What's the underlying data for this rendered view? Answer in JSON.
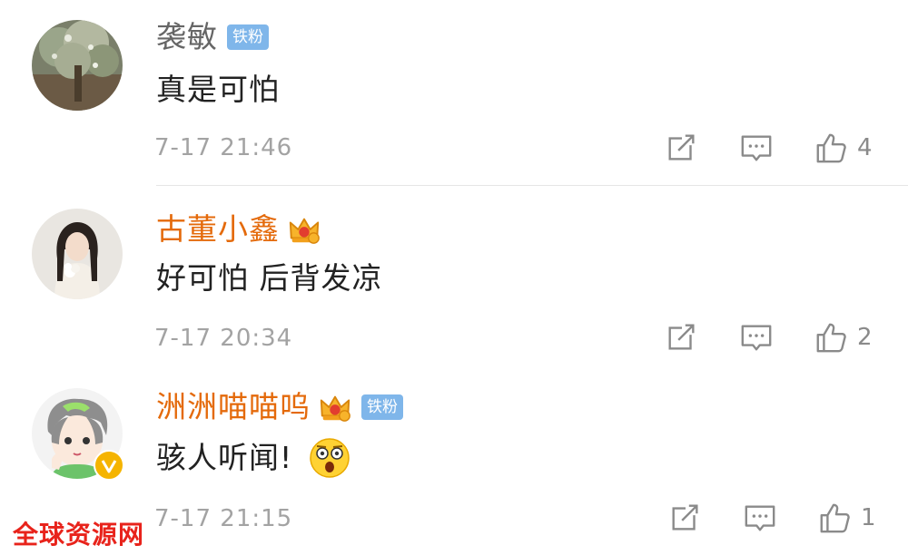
{
  "colors": {
    "username_plain": "#666666",
    "username_vip": "#e46a0b",
    "fan_badge": "#7fb6ea",
    "meta": "#a3a3a3",
    "watermark": "#e8231b"
  },
  "comments": [
    {
      "username": "袭敏",
      "badges": [
        "fan-badge"
      ],
      "fan_badge_label": "铁粉",
      "text": "真是可怕",
      "time": "7-17 21:46",
      "likes": "4",
      "avatar_icon": "tree-photo-avatar"
    },
    {
      "username": "古董小鑫",
      "badges": [
        "crown-icon"
      ],
      "text": "好可怕 后背发凉",
      "time": "7-17 20:34",
      "likes": "2",
      "avatar_icon": "girl-photo-avatar"
    },
    {
      "username": "洲洲喵喵呜",
      "badges": [
        "crown-icon",
        "fan-badge"
      ],
      "fan_badge_label": "铁粉",
      "text": "骇人听闻!",
      "emoji": "shocked-face-emoji",
      "time": "7-17 21:15",
      "likes": "1",
      "avatar_icon": "cartoon-boy-avatar",
      "verified": "verified-v-badge"
    }
  ],
  "watermark": "全球资源网"
}
